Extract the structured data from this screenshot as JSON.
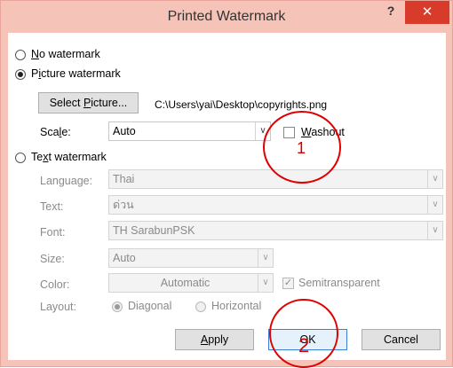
{
  "window": {
    "title": "Printed Watermark",
    "help_glyph": "?",
    "close_glyph": "✕"
  },
  "options": {
    "no_watermark": "No watermark",
    "picture_watermark": "Picture watermark",
    "text_watermark": "Text watermark"
  },
  "picture": {
    "select_button": "Select Picture...",
    "path": "C:\\Users\\yai\\Desktop\\copyrights.png",
    "scale_label": "Scale:",
    "scale_value": "Auto",
    "washout_label": "Washout",
    "washout_checked": false
  },
  "text": {
    "language_label": "Language:",
    "language_value": "Thai",
    "text_label": "Text:",
    "text_value": "ด่วน",
    "font_label": "Font:",
    "font_value": "TH SarabunPSK",
    "size_label": "Size:",
    "size_value": "Auto",
    "color_label": "Color:",
    "color_value": "Automatic",
    "semitransparent_label": "Semitransparent",
    "semitransparent_checked": true,
    "layout_label": "Layout:",
    "diagonal_label": "Diagonal",
    "horizontal_label": "Horizontal",
    "layout_selected": "Diagonal"
  },
  "buttons": {
    "apply": "Apply",
    "ok": "OK",
    "cancel": "Cancel"
  },
  "annotations": {
    "one": "1",
    "two": "2",
    "color": "#e00000"
  }
}
